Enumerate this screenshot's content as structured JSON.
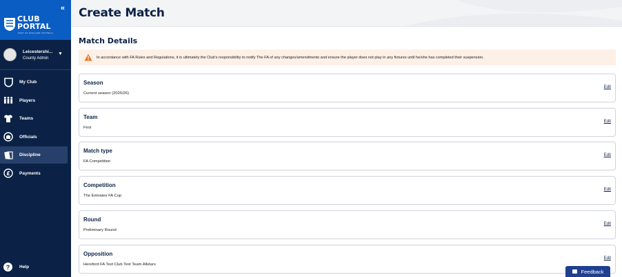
{
  "brand": {
    "line1": "CLUB",
    "line2": "PORTAL",
    "tagline": "PART OF ENGLAND FOOTBALL"
  },
  "user": {
    "name": "Leicestershi...",
    "role": "County Admin"
  },
  "nav": {
    "items": [
      {
        "label": "My Club",
        "icon": "shield-icon"
      },
      {
        "label": "Players",
        "icon": "players-icon"
      },
      {
        "label": "Teams",
        "icon": "shirt-icon"
      },
      {
        "label": "Officials",
        "icon": "whistle-icon"
      },
      {
        "label": "Discipline",
        "icon": "cards-icon",
        "active": true
      },
      {
        "label": "Payments",
        "icon": "pound-icon"
      }
    ],
    "help": "Help"
  },
  "page": {
    "title": "Create Match",
    "section_title": "Match Details"
  },
  "warning": "In accordance with FA Rules and Regulations, it is ultimately the Club's responsibility to notify The FA of any changes/amendments and ensure the player does not play in any fixtures until he/she has completed their suspension.",
  "fields": [
    {
      "title": "Season",
      "value": "Current season (2025/26)",
      "edit": "Edit"
    },
    {
      "title": "Team",
      "value": "First",
      "edit": "Edit"
    },
    {
      "title": "Match type",
      "value": "FA Competition",
      "edit": "Edit"
    },
    {
      "title": "Competition",
      "value": "The Emirates FA Cup",
      "edit": "Edit"
    },
    {
      "title": "Round",
      "value": "Preliminary Round",
      "edit": "Edit"
    },
    {
      "title": "Opposition",
      "value": "Hereford FA Test Club Test Team Allstars",
      "edit": "Edit"
    }
  ],
  "feedback": "Feedback",
  "colors": {
    "sidebar": "#0b2246",
    "brand": "#0a5dc2",
    "warning_bg": "#fdf0e6",
    "warning_icon": "#e8731f",
    "feedback": "#1f3f8f"
  }
}
